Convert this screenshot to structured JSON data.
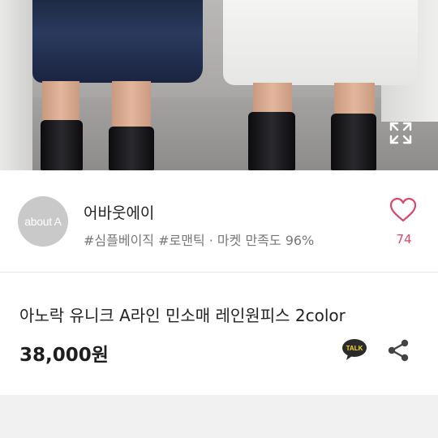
{
  "photo": {
    "alt": "product-photo",
    "expand_icon": "expand-icon"
  },
  "seller": {
    "avatar_logo": "about A",
    "name": "어바웃에이",
    "tags": "#심플베이직 #로맨틱 · 마켓 만족도 96%",
    "like_icon": "heart-icon",
    "like_count": "74",
    "accent_color": "#d6476a"
  },
  "product": {
    "title": "아노락 유니크 A라인 민소매 레인원피스 2color",
    "price": "38,000원",
    "kakao_icon_label": "TALK",
    "share_icon": "share-icon"
  }
}
